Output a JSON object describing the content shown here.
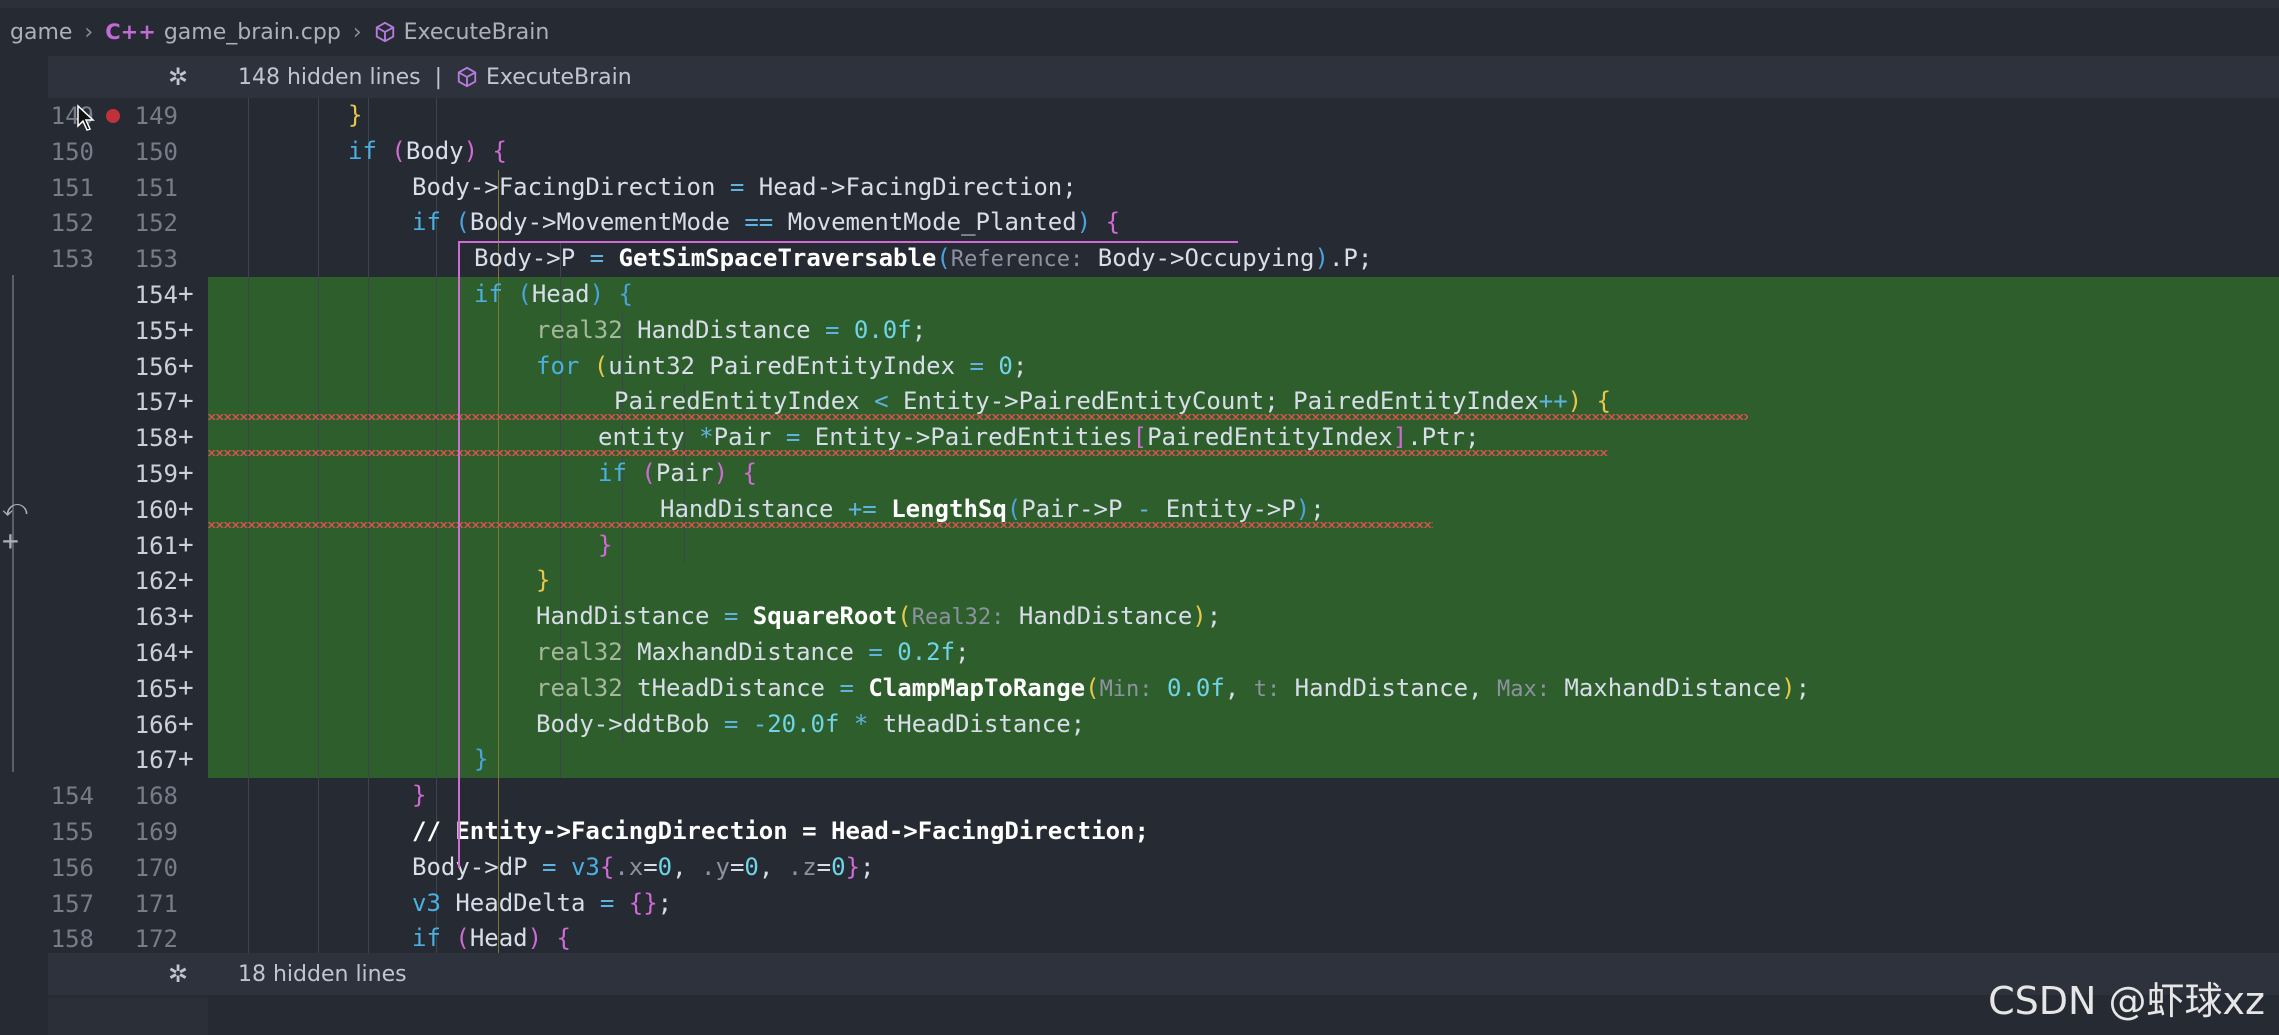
{
  "breadcrumb": {
    "items": [
      "game",
      "game_brain.cpp",
      "ExecuteBrain"
    ],
    "cpp_icon": "C++"
  },
  "fold_top": {
    "text": "148 hidden lines",
    "separator": "|",
    "symbol": "ExecuteBrain"
  },
  "fold_bottom": {
    "text": "18 hidden lines"
  },
  "lines": [
    {
      "old": "149",
      "new": "149",
      "added": false
    },
    {
      "old": "150",
      "new": "150",
      "added": false
    },
    {
      "old": "151",
      "new": "151",
      "added": false
    },
    {
      "old": "152",
      "new": "152",
      "added": false
    },
    {
      "old": "153",
      "new": "153",
      "added": false
    },
    {
      "old": "",
      "new": "154",
      "added": true
    },
    {
      "old": "",
      "new": "155",
      "added": true
    },
    {
      "old": "",
      "new": "156",
      "added": true
    },
    {
      "old": "",
      "new": "157",
      "added": true
    },
    {
      "old": "",
      "new": "158",
      "added": true
    },
    {
      "old": "",
      "new": "159",
      "added": true
    },
    {
      "old": "",
      "new": "160",
      "added": true
    },
    {
      "old": "",
      "new": "161",
      "added": true
    },
    {
      "old": "",
      "new": "162",
      "added": true
    },
    {
      "old": "",
      "new": "163",
      "added": true
    },
    {
      "old": "",
      "new": "164",
      "added": true
    },
    {
      "old": "",
      "new": "165",
      "added": true
    },
    {
      "old": "",
      "new": "166",
      "added": true
    },
    {
      "old": "",
      "new": "167",
      "added": true
    },
    {
      "old": "154",
      "new": "168",
      "added": false
    },
    {
      "old": "155",
      "new": "169",
      "added": false
    },
    {
      "old": "156",
      "new": "170",
      "added": false
    },
    {
      "old": "157",
      "new": "171",
      "added": false
    },
    {
      "old": "158",
      "new": "172",
      "added": false
    }
  ],
  "plus_marker": "+",
  "watermark": "CSDN @虾球xz"
}
